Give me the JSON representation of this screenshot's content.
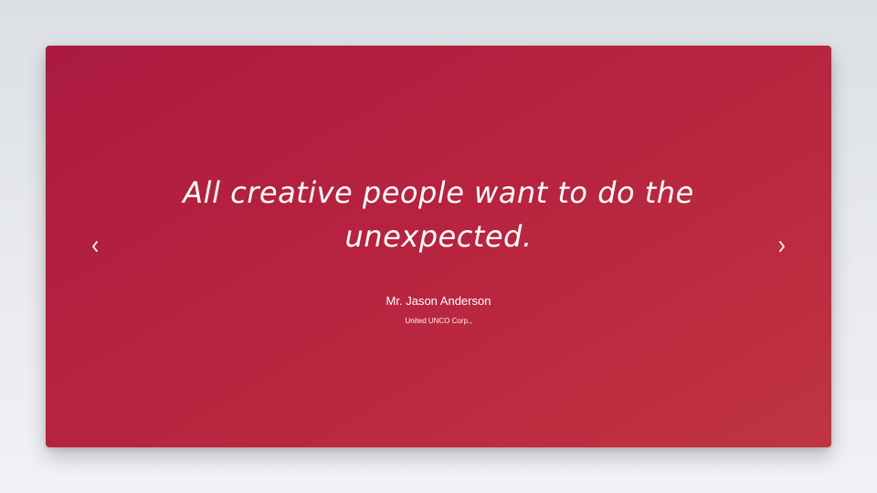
{
  "testimonial": {
    "quote": "All creative people want to do the unexpected.",
    "author": "Mr. Jason Anderson",
    "company": "United UNCO Corp.,"
  },
  "controls": {
    "prev_icon": "chevron-left-icon",
    "next_icon": "chevron-right-icon"
  },
  "colors": {
    "card_start": "#ab1a40",
    "card_end": "#c03441",
    "text": "#ffffff",
    "page_background": "#e8eaee"
  }
}
